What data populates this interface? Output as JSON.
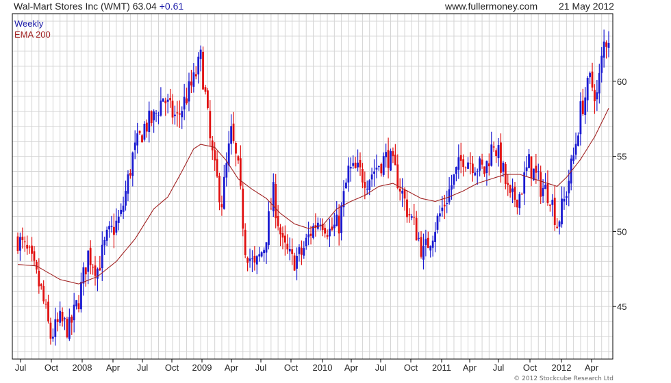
{
  "header": {
    "title": "Wal-Mart Stores Inc (WMT) 63.04",
    "change": "+0.61",
    "site": "www.fullermoney.com",
    "date": "21 May 2012"
  },
  "footer": {
    "copyright": "© 2012 Stockcube Research Ltd"
  },
  "chart_data": {
    "type": "candlestick-weekly",
    "legend": [
      {
        "label": "Weekly",
        "color": "#1a1aa8"
      },
      {
        "label": "EMA 200",
        "color": "#a02020"
      }
    ],
    "colors": {
      "up": "#1a1ad0",
      "down": "#e01010",
      "ema": "#a02020",
      "grid": "#d4d4d4"
    },
    "x_ticks": [
      "Jul",
      "Oct",
      "2008",
      "Apr",
      "Jul",
      "Oct",
      "2009",
      "Apr",
      "Jul",
      "Oct",
      "2010",
      "Apr",
      "Jul",
      "Oct",
      "2011",
      "Apr",
      "Jul",
      "Oct",
      "2012",
      "Apr"
    ],
    "y_ticks": [
      45,
      50,
      55,
      60
    ],
    "y_range": [
      41.5,
      64.5
    ],
    "x_range_weeks": [
      0,
      252
    ],
    "grid": true,
    "price_anchors": [
      [
        0,
        49.5
      ],
      [
        5,
        48.3
      ],
      [
        10,
        46.0
      ],
      [
        14,
        43.0
      ],
      [
        18,
        44.0
      ],
      [
        22,
        43.5
      ],
      [
        26,
        45.5
      ],
      [
        30,
        48.5
      ],
      [
        34,
        47.5
      ],
      [
        38,
        49.5
      ],
      [
        44,
        51.0
      ],
      [
        49,
        55.0
      ],
      [
        54,
        57.0
      ],
      [
        58,
        57.5
      ],
      [
        62,
        59.0
      ],
      [
        65,
        58.0
      ],
      [
        68,
        57.5
      ],
      [
        72,
        59.0
      ],
      [
        75,
        60.0
      ],
      [
        78,
        61.5
      ],
      [
        80,
        59.0
      ],
      [
        82,
        56.0
      ],
      [
        84,
        54.0
      ],
      [
        87,
        52.0
      ],
      [
        91,
        56.5
      ],
      [
        94,
        54.0
      ],
      [
        97,
        49.0
      ],
      [
        101,
        47.5
      ],
      [
        105,
        49.0
      ],
      [
        109,
        52.5
      ],
      [
        113,
        49.0
      ],
      [
        117,
        48.0
      ],
      [
        121,
        48.5
      ],
      [
        125,
        50.0
      ],
      [
        129,
        51.0
      ],
      [
        133,
        50.0
      ],
      [
        137,
        50.5
      ],
      [
        141,
        54.0
      ],
      [
        145,
        54.0
      ],
      [
        149,
        53.5
      ],
      [
        154,
        54.5
      ],
      [
        158,
        55.0
      ],
      [
        162,
        53.5
      ],
      [
        166,
        51.5
      ],
      [
        170,
        50.0
      ],
      [
        173,
        48.5
      ],
      [
        177,
        50.0
      ],
      [
        181,
        51.5
      ],
      [
        186,
        53.5
      ],
      [
        190,
        55.0
      ],
      [
        195,
        54.5
      ],
      [
        199,
        54.0
      ],
      [
        203,
        56.0
      ],
      [
        206,
        54.5
      ],
      [
        210,
        52.0
      ],
      [
        214,
        52.5
      ],
      [
        218,
        54.5
      ],
      [
        223,
        53.0
      ],
      [
        227,
        52.5
      ],
      [
        230,
        50.5
      ],
      [
        233,
        52.0
      ],
      [
        237,
        55.0
      ],
      [
        240,
        58.0
      ],
      [
        244,
        60.0
      ],
      [
        247,
        59.0
      ],
      [
        250,
        62.5
      ],
      [
        252,
        63.0
      ]
    ],
    "ema_anchors": [
      [
        0,
        47.8
      ],
      [
        8,
        47.7
      ],
      [
        18,
        46.8
      ],
      [
        26,
        46.5
      ],
      [
        34,
        47.0
      ],
      [
        42,
        48.0
      ],
      [
        50,
        49.5
      ],
      [
        58,
        51.5
      ],
      [
        64,
        52.3
      ],
      [
        70,
        54.0
      ],
      [
        75,
        55.5
      ],
      [
        78,
        55.8
      ],
      [
        84,
        55.6
      ],
      [
        89,
        54.7
      ],
      [
        94,
        53.5
      ],
      [
        100,
        52.8
      ],
      [
        106,
        52.2
      ],
      [
        112,
        51.2
      ],
      [
        118,
        50.5
      ],
      [
        124,
        50.2
      ],
      [
        130,
        50.4
      ],
      [
        136,
        51.5
      ],
      [
        142,
        52.0
      ],
      [
        148,
        52.4
      ],
      [
        154,
        53.0
      ],
      [
        160,
        53.2
      ],
      [
        166,
        52.7
      ],
      [
        172,
        52.2
      ],
      [
        178,
        52.0
      ],
      [
        184,
        52.3
      ],
      [
        190,
        52.7
      ],
      [
        196,
        53.2
      ],
      [
        202,
        53.5
      ],
      [
        208,
        53.8
      ],
      [
        214,
        53.8
      ],
      [
        220,
        53.5
      ],
      [
        226,
        53.2
      ],
      [
        230,
        53.0
      ],
      [
        234,
        53.6
      ],
      [
        240,
        54.8
      ],
      [
        246,
        56.3
      ],
      [
        252,
        58.2
      ]
    ]
  }
}
